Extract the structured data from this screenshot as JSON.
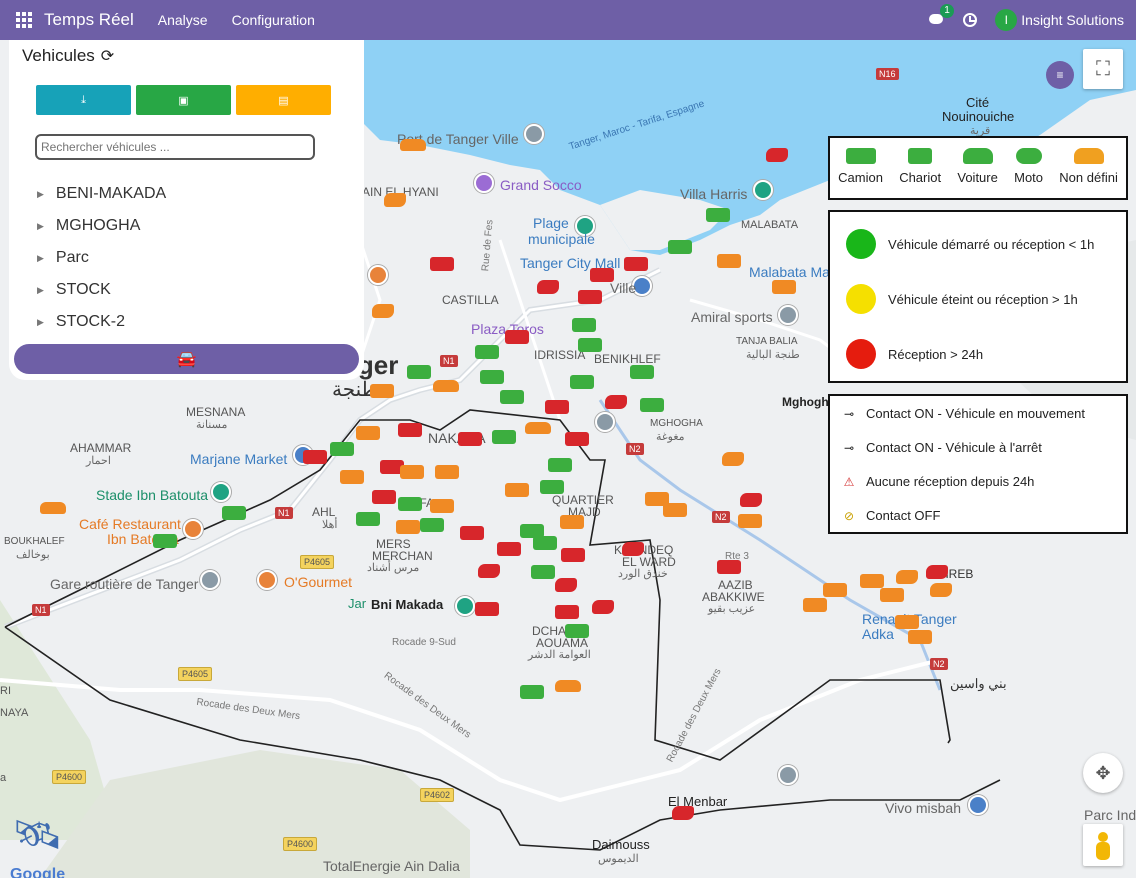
{
  "topbar": {
    "brand": "Temps Réel",
    "menu": [
      "Analyse",
      "Configuration"
    ],
    "messages_count": "1",
    "user_initial": "I",
    "user_name": "Insight Solutions"
  },
  "panel": {
    "title": "Vehicules",
    "search_placeholder": "Rechercher véhicules ...",
    "groups": [
      "BENI-MAKADA",
      "MGHOGHA",
      "Parc",
      "STOCK",
      "STOCK-2"
    ]
  },
  "legend": {
    "types": [
      {
        "label": "Camion",
        "color": "#3cae3f"
      },
      {
        "label": "Chariot",
        "color": "#3cae3f"
      },
      {
        "label": "Voiture",
        "color": "#3cae3f"
      },
      {
        "label": "Moto",
        "color": "#3cae3f"
      },
      {
        "label": "Non défini",
        "color": "#f0a020"
      }
    ],
    "status": [
      {
        "label": "Véhicule démarré ou réception < 1h",
        "color": "#19b619"
      },
      {
        "label": "Véhicule éteint ou réception > 1h",
        "color": "#f5e000"
      },
      {
        "label": "Réception > 24h",
        "color": "#e51c0e"
      }
    ],
    "contact": [
      {
        "label": "Contact ON - Véhicule en mouvement",
        "icon": "key-moving-icon"
      },
      {
        "label": "Contact ON - Véhicule à l'arrêt",
        "icon": "key-icon"
      },
      {
        "label": "Aucune réception depuis 24h",
        "icon": "warning-icon"
      },
      {
        "label": "Contact OFF",
        "icon": "key-off-icon"
      }
    ]
  },
  "map": {
    "labels": {
      "port": "Port de Tanger Ville",
      "ain_el_hyani": "AIN EL HYANI",
      "grand_socco": "Grand Socco",
      "plage": "Plage",
      "municipale": "municipale",
      "tanger_city_mall": "Tanger City Mall",
      "ville": "Ville",
      "castilla": "CASTILLA",
      "plaza_toros": "Plaza Toros",
      "idrissia": "IDRISSIA",
      "benikhlef": "BENIKHLEF",
      "tanger": "nger",
      "tanja": "طنجة",
      "mesnana": "MESNANA",
      "mesnana_ar": "مسنانة",
      "ahammar": "AHAMMAR",
      "ahammar_ar": "احمار",
      "marjane": "Marjane Market",
      "stade": "Stade Ibn Batouta",
      "cafe": "Café Restaurant",
      "cafe2": "Ibn Batouta",
      "ahlane": "AHL",
      "ahlane_ar": "أهلا",
      "boukhalef": "BOUKHALEF",
      "boukhalef_ar": "بوخالف",
      "gare": "Gare routière de Tanger",
      "ogourmet": "O'Gourmet",
      "jardin": "Jar",
      "bni_makada": "Bni Makada",
      "mers": "MERS",
      "mers2": "MERCHAN",
      "mers_ar": "مرس أشناد",
      "hiffa": "HIFFA",
      "nakada": "NAKADA",
      "quartier": "QUARTIER",
      "majd": "MAJD",
      "dchar": "DCHAR",
      "aouama": "AOUAMA",
      "aouama_ar": "العوامة الدشر",
      "khandeq": "KHANDEQ",
      "el_ward": "EL WARD",
      "khandeq_ar": "خندق الورد",
      "aazib": "AAZIB",
      "abakkiwe": "ABAKKIWE",
      "aazib_ar": "عزيب بقيو",
      "mghogha": "MGHOGHA",
      "mghogha_ar": "مغوغة",
      "mghogha_bold": "Mghogh",
      "amiral": "Amiral sports",
      "tanja_balia": "TANJA BALIA",
      "tanja_balia_ar": "طنجة البالية",
      "malabata": "MALABATA",
      "malabata_mall": "Malabata Ma",
      "villa_harris": "Villa Harris",
      "cite": "Cité",
      "nouinouiche": "Nouinouiche",
      "nouinouiche_ar": "قرية",
      "ferry": "Tanger, Maroc - Tarifa, Espagne",
      "rue_fes": "Rue de Fes",
      "rocade_9": "Rocade 9-Sud",
      "rocade_deux": "Rocade des Deux Mers",
      "rocade_deux2": "Rocade des Deux Mers",
      "rocade_deux3": "Rocade des Deux Mers",
      "el_menbar": "El Menbar",
      "daimouss": "Daimouss",
      "daimouss_ar": "الديموس",
      "vivo": "Vivo misbah",
      "parc_ind": "Parc Ind",
      "total": "TotalEnergie Ain Dalia",
      "beni_ouassine": "بني واسين",
      "rte3": "Rte 3",
      "renault": "Renault Tanger",
      "renault2": "Adka",
      "hreb": "HREB",
      "ri": "RI",
      "naya": "NAYA",
      "ina": "a"
    },
    "shields": {
      "n16": "N16",
      "n1a": "N1",
      "n1b": "N1",
      "n2a": "N2",
      "n2b": "N2",
      "n2c": "N2",
      "p4605a": "P4605",
      "p4605b": "P4605",
      "p4600": "P4600",
      "p4602": "P4602",
      "p4600b": "P4600",
      "n1c": "N1"
    },
    "attribution": "Google"
  }
}
